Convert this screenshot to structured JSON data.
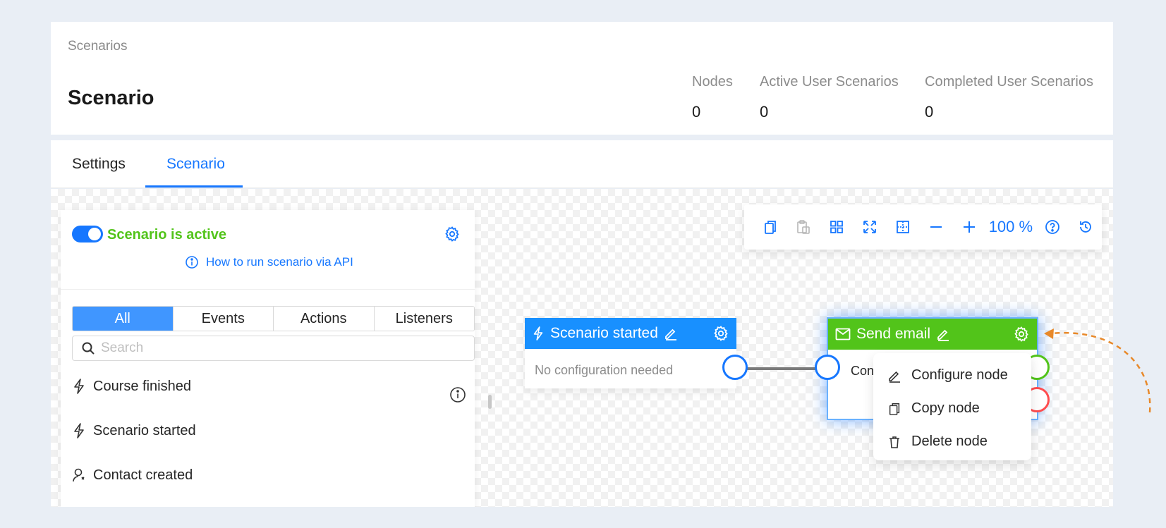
{
  "header": {
    "breadcrumb": "Scenarios",
    "title": "Scenario",
    "stats": [
      {
        "label": "Nodes",
        "value": "0"
      },
      {
        "label": "Active User Scenarios",
        "value": "0"
      },
      {
        "label": "Completed User Scenarios",
        "value": "0"
      }
    ]
  },
  "tabs": [
    {
      "label": "Settings",
      "active": false
    },
    {
      "label": "Scenario",
      "active": true
    }
  ],
  "panel": {
    "status_label": "Scenario is active",
    "status_active": true,
    "api_link": "How to run scenario via API",
    "filters": [
      "All",
      "Events",
      "Actions",
      "Listeners"
    ],
    "active_filter": "All",
    "search_placeholder": "Search",
    "items": [
      {
        "label": "Course finished",
        "icon": "bolt-icon"
      },
      {
        "label": "Scenario started",
        "icon": "bolt-icon"
      },
      {
        "label": "Contact created",
        "icon": "user-icon"
      }
    ]
  },
  "toolbar": {
    "zoom": "100 %",
    "buttons": [
      "copy-icon",
      "paste-icon",
      "grid-icon",
      "fit-view-icon",
      "select-area-icon",
      "zoom-out-icon",
      "zoom-in-icon",
      "help-icon",
      "history-icon"
    ]
  },
  "nodes": [
    {
      "title": "Scenario started",
      "body": "No configuration needed",
      "color": "#1890ff"
    },
    {
      "title": "Send email",
      "body": "Configure",
      "color": "#52c41a"
    }
  ],
  "context_menu": {
    "items": [
      "Configure node",
      "Copy node",
      "Delete node"
    ]
  },
  "colors": {
    "accent": "#1677ff",
    "success": "#52c41a",
    "danger": "#ff4d4f",
    "annotation": "#e8892a"
  }
}
